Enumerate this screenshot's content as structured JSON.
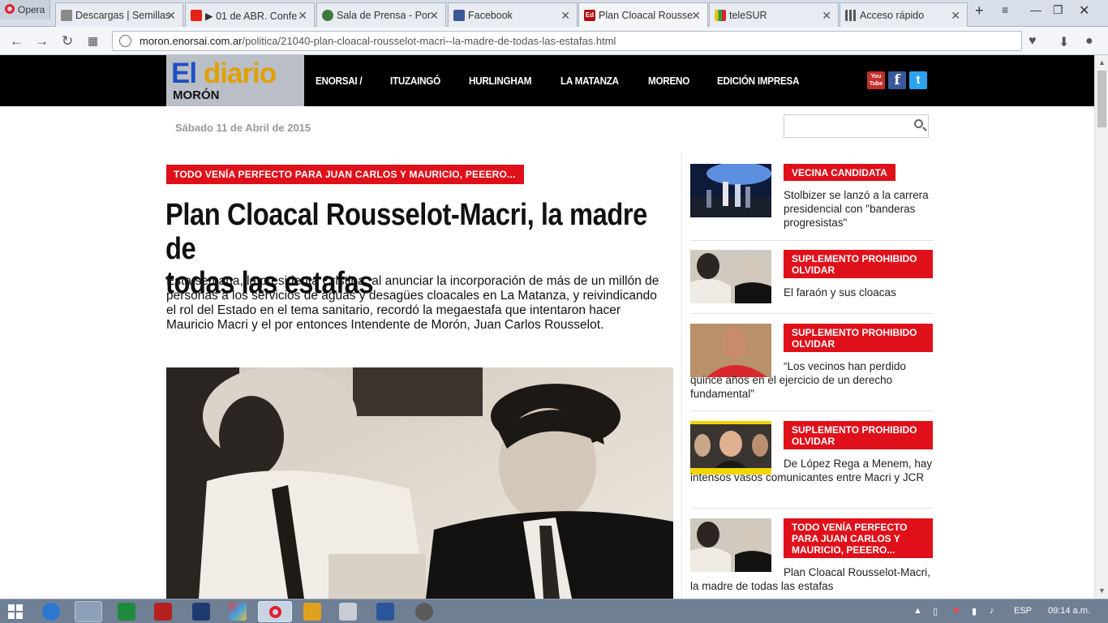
{
  "browser": {
    "opera_label": "Opera",
    "tabs": [
      {
        "label": "Descargas | Semillas",
        "color": "#8a8a8a"
      },
      {
        "label": "▶ 01 de ABR. Confe",
        "color": "#e62117"
      },
      {
        "label": "Sala de Prensa - Por",
        "color": "#3d7a3d"
      },
      {
        "label": "Facebook",
        "color": "#3b5998"
      },
      {
        "label": "Plan Cloacal Rousse",
        "color": "#b01010"
      },
      {
        "label": "teleSUR",
        "color": "#2e9d3a"
      },
      {
        "label": "Acceso rápido",
        "color": "#555555"
      }
    ],
    "url_host": "moron.enorsai.com.ar",
    "url_path": "/politica/21040-plan-cloacal-rousselot-macri--la-madre-de-todas-las-estafas.html"
  },
  "site": {
    "logo_line1_a": "El",
    "logo_line1_b": "diario",
    "logo_line2": "MORÓN",
    "nav": [
      "ENORSAI /",
      "ITUZAINGÓ",
      "HURLINGHAM",
      "LA MATANZA",
      "MORENO",
      "EDICIÓN IMPRESA"
    ],
    "social": [
      {
        "label": "You Tube",
        "color": "#c4302b"
      },
      {
        "label": "f",
        "color": "#3b5998"
      },
      {
        "label": "t",
        "color": "#2aa3ef"
      }
    ],
    "date": "Sábado 11 de Abril de 2015",
    "search_placeholder": ""
  },
  "article": {
    "kicker": "TODO VENÍA PERFECTO PARA JUAN CARLOS Y MAURICIO, PEEERO...",
    "headline_l1": "Plan Cloacal Rousselot-Macri, la madre de",
    "headline_l2": "todas las estafas",
    "lead": "Esta semana, la presidenta Cristina, al anunciar la incorporación de más de un millón de personas a los servicios de aguas y desagües cloacales en La Matanza, y reivindicando el rol del Estado en el tema sanitario, recordó la megaestafa que intentaron hacer Mauricio Macri y el por entonces Intendente de Morón, Juan Carlos Rousselot."
  },
  "sidebar": [
    {
      "badge": "VECINA CANDIDATA",
      "text": "Stolbizer se lanzó a la carrera presidencial con \"banderas progresistas\""
    },
    {
      "badge": "SUPLEMENTO PROHIBIDO OLVIDAR",
      "text": "El faraón y sus cloacas"
    },
    {
      "badge": "SUPLEMENTO PROHIBIDO OLVIDAR",
      "text": "“Los vecinos han perdido quince años en el ejercicio de un derecho fundamental”"
    },
    {
      "badge": "SUPLEMENTO PROHIBIDO OLVIDAR",
      "text": "De López Rega a Menem, hay intensos vasos comunicantes entre Macri y JCR"
    },
    {
      "badge": "TODO VENÍA PERFECTO PARA JUAN CARLOS Y MAURICIO, PEEERO...",
      "text": "Plan Cloacal Rousselot-Macri, la madre de todas las estafas"
    }
  ],
  "taskbar": {
    "lang": "ESP",
    "time": "09:14 a.m."
  }
}
